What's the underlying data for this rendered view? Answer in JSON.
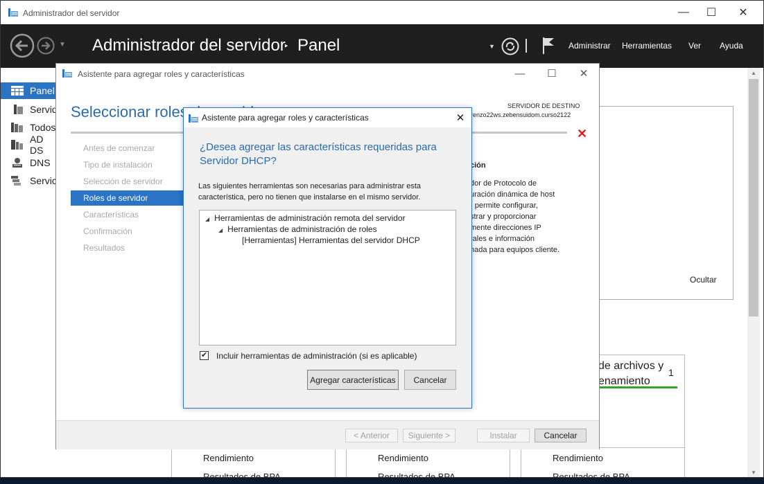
{
  "server_manager": {
    "title": "Administrador del servidor",
    "header_title": "Administrador del servidor",
    "breadcrumb_separator": "‣",
    "header_page": "Panel",
    "menu": [
      "Administrar",
      "Herramientas",
      "Ver",
      "Ayuda"
    ],
    "window_buttons": {
      "minimize": "—",
      "maximize": "☐",
      "close": "✕"
    },
    "sidebar": [
      {
        "label": "Panel",
        "icon": "dashboard-icon",
        "active": true
      },
      {
        "label": "Servid",
        "icon": "server-icon",
        "active": false
      },
      {
        "label": "Todos",
        "icon": "all-servers-icon",
        "active": false
      },
      {
        "label": "AD DS",
        "icon": "ad-ds-icon",
        "active": false
      },
      {
        "label": "DNS",
        "icon": "dns-icon",
        "active": false
      },
      {
        "label": "Servici",
        "icon": "services-icon",
        "active": false
      }
    ],
    "welcome_hide": "Ocultar",
    "tiles": {
      "files_title": "de archivos y\nenamiento",
      "files_count": "1",
      "rendimiento": "Rendimiento",
      "bpa": "Resultados de BPA"
    }
  },
  "wizard": {
    "title": "Asistente para agregar roles y características",
    "heading": "Seleccionar roles de servidor",
    "destination_label": "SERVIDOR DE DESTINO",
    "destination_server": "renzo22ws.zebensuidom.curso2122",
    "steps": [
      {
        "label": "Antes de comenzar",
        "active": false
      },
      {
        "label": "Tipo de instalación",
        "active": false
      },
      {
        "label": "Selección de servidor",
        "active": false
      },
      {
        "label": "Roles de servidor",
        "active": true
      },
      {
        "label": "Características",
        "active": false
      },
      {
        "label": "Confirmación",
        "active": false
      },
      {
        "label": "Resultados",
        "active": false
      }
    ],
    "description_heading": "ción",
    "description_lines": [
      "dor de Protocolo de",
      "uración dinámica de host",
      ") permite configurar,",
      "strar y proporcionar",
      "mente direcciones IP",
      "rales e información",
      "nada para equipos cliente."
    ],
    "buttons": {
      "previous": "< Anterior",
      "next": "Siguiente >",
      "install": "Instalar",
      "cancel": "Cancelar"
    }
  },
  "dialog": {
    "title": "Asistente para agregar roles y características",
    "close": "✕",
    "heading": "¿Desea agregar las características requeridas para Servidor DHCP?",
    "description": "Las siguientes herramientas son necesarias para administrar esta característica, pero no tienen que instalarse en el mismo servidor.",
    "tree": [
      {
        "label": "Herramientas de administración remota del servidor",
        "level": 0,
        "expanded": true
      },
      {
        "label": "Herramientas de administración de roles",
        "level": 1,
        "expanded": true
      },
      {
        "label": "[Herramientas] Herramientas del servidor DHCP",
        "level": 2,
        "expanded": false
      }
    ],
    "include_tools_label": "Incluir herramientas de administración (si es aplicable)",
    "include_tools_checked": true,
    "add_button": "Agregar características",
    "cancel_button": "Cancelar"
  },
  "colors": {
    "accent": "#2b73c4",
    "heading_blue": "#2a6bb0",
    "header_dark": "#1f1f1f",
    "error_red": "#e02020",
    "status_green": "#2ea828"
  }
}
